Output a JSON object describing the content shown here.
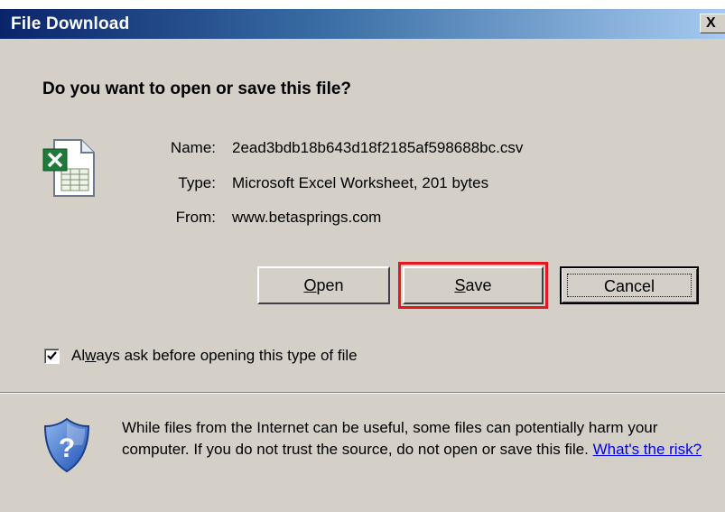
{
  "window": {
    "title": "File Download",
    "close_glyph": "X"
  },
  "dialog": {
    "question": "Do you want to open or save this file?",
    "file_icon": "excel-file-icon",
    "fields": {
      "name_label": "Name:",
      "name_value": "2ead3bdb18b643d18f2185af598688bc.csv",
      "type_label": "Type:",
      "type_value": "Microsoft Excel Worksheet, 201 bytes",
      "from_label": "From:",
      "from_value": "www.betasprings.com"
    },
    "buttons": {
      "open": {
        "mnemonic": "O",
        "rest": "pen"
      },
      "save": {
        "mnemonic": "S",
        "rest": "ave"
      },
      "cancel": "Cancel"
    },
    "checkbox": {
      "checked": true,
      "label_before": "Al",
      "label_mnemonic": "w",
      "label_after": "ays ask before opening this type of file"
    },
    "warning": {
      "icon": "shield-question-icon",
      "text": "While files from the Internet can be useful, some files can potentially harm your computer. If you do not trust the source, do not open or save this file.",
      "link": "What's the risk?"
    },
    "highlight_color": "#e8141e"
  }
}
